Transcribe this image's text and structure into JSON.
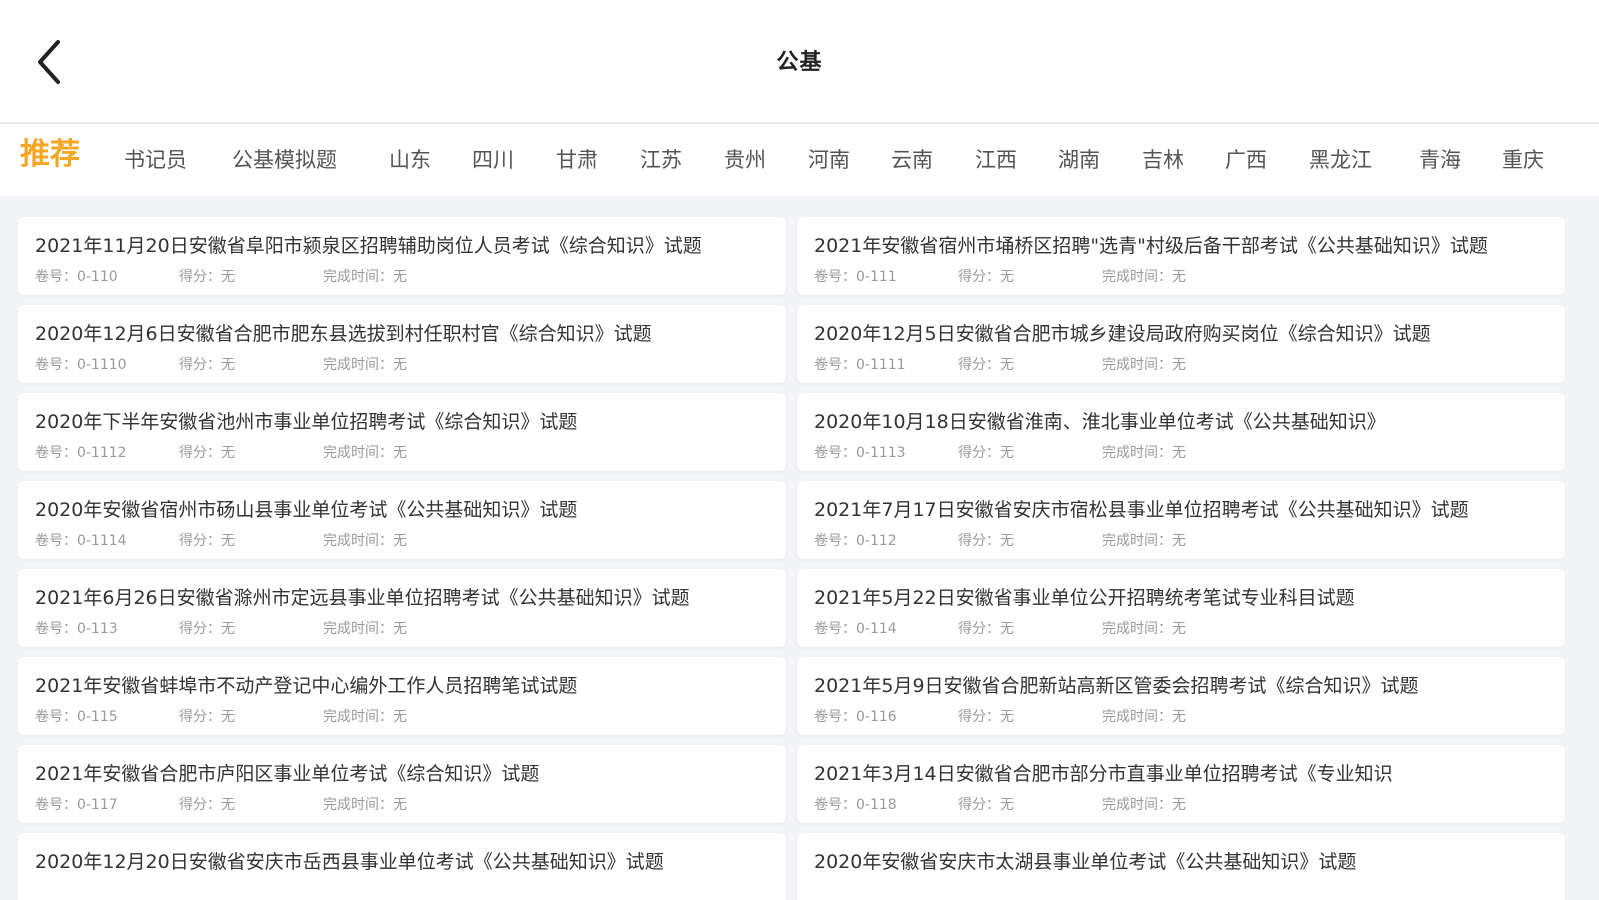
{
  "header": {
    "title": "公基",
    "back_icon": "chevron-left-icon"
  },
  "tabs": [
    {
      "label": "推荐",
      "active": true
    },
    {
      "label": "书记员"
    },
    {
      "label": "公基模拟题"
    },
    {
      "label": "山东"
    },
    {
      "label": "四川"
    },
    {
      "label": "甘肃"
    },
    {
      "label": "江苏"
    },
    {
      "label": "贵州"
    },
    {
      "label": "河南"
    },
    {
      "label": "云南"
    },
    {
      "label": "江西"
    },
    {
      "label": "湖南"
    },
    {
      "label": "吉林"
    },
    {
      "label": "广西"
    },
    {
      "label": "黑龙江"
    },
    {
      "label": "青海"
    },
    {
      "label": "重庆"
    }
  ],
  "meta_labels": {
    "paper_no": "卷号：",
    "score": "得分：",
    "completed": "完成时间："
  },
  "papers": [
    {
      "title": "2021年11月20日安徽省阜阳市颍泉区招聘辅助岗位人员考试《综合知识》试题",
      "paper_no": "0-110",
      "score": "无",
      "completed": "无"
    },
    {
      "title": "2021年安徽省宿州市埇桥区招聘\"选青\"村级后备干部考试《公共基础知识》试题",
      "paper_no": "0-111",
      "score": "无",
      "completed": "无"
    },
    {
      "title": "2020年12月6日安徽省合肥市肥东县选拔到村任职村官《综合知识》试题",
      "paper_no": "0-1110",
      "score": "无",
      "completed": "无"
    },
    {
      "title": "2020年12月5日安徽省合肥市城乡建设局政府购买岗位《综合知识》试题",
      "paper_no": "0-1111",
      "score": "无",
      "completed": "无"
    },
    {
      "title": "2020年下半年安徽省池州市事业单位招聘考试《综合知识》试题",
      "paper_no": "0-1112",
      "score": "无",
      "completed": "无"
    },
    {
      "title": "2020年10月18日安徽省淮南、淮北事业单位考试《公共基础知识》",
      "paper_no": "0-1113",
      "score": "无",
      "completed": "无"
    },
    {
      "title": "2020年安徽省宿州市砀山县事业单位考试《公共基础知识》试题",
      "paper_no": "0-1114",
      "score": "无",
      "completed": "无"
    },
    {
      "title": "2021年7月17日安徽省安庆市宿松县事业单位招聘考试《公共基础知识》试题",
      "paper_no": "0-112",
      "score": "无",
      "completed": "无"
    },
    {
      "title": "2021年6月26日安徽省滁州市定远县事业单位招聘考试《公共基础知识》试题",
      "paper_no": "0-113",
      "score": "无",
      "completed": "无"
    },
    {
      "title": "2021年5月22日安徽省事业单位公开招聘统考笔试专业科目试题",
      "paper_no": "0-114",
      "score": "无",
      "completed": "无"
    },
    {
      "title": "2021年安徽省蚌埠市不动产登记中心编外工作人员招聘笔试试题",
      "paper_no": "0-115",
      "score": "无",
      "completed": "无"
    },
    {
      "title": "2021年5月9日安徽省合肥新站高新区管委会招聘考试《综合知识》试题",
      "paper_no": "0-116",
      "score": "无",
      "completed": "无"
    },
    {
      "title": "2021年安徽省合肥市庐阳区事业单位考试《综合知识》试题",
      "paper_no": "0-117",
      "score": "无",
      "completed": "无"
    },
    {
      "title": "2021年3月14日安徽省合肥市部分市直事业单位招聘考试《专业知识",
      "paper_no": "0-118",
      "score": "无",
      "completed": "无"
    },
    {
      "title": "2020年12月20日安徽省安庆市岳西县事业单位考试《公共基础知识》试题",
      "paper_no": "",
      "score": "",
      "completed": ""
    },
    {
      "title": "2020年安徽省安庆市太湖县事业单位考试《公共基础知识》试题",
      "paper_no": "",
      "score": "",
      "completed": ""
    }
  ],
  "colors": {
    "accent": "#f5a623",
    "background": "#f2f4f8",
    "card": "#ffffff"
  }
}
